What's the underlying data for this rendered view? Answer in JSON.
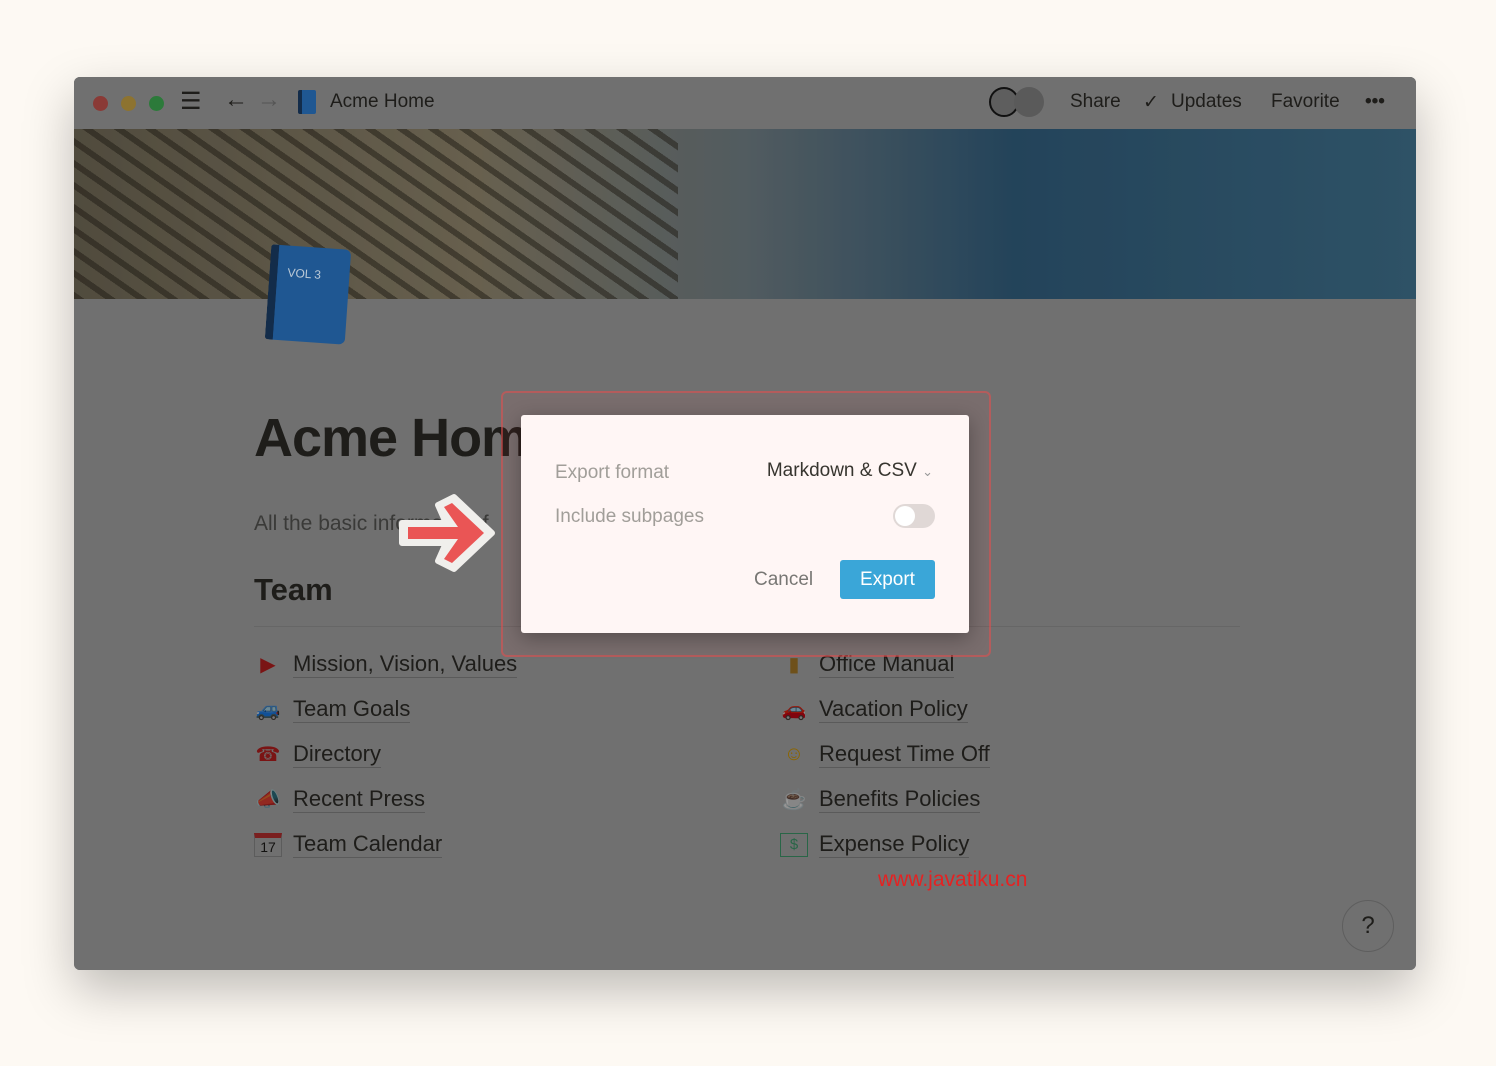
{
  "window": {
    "title": "Acme Home",
    "icon": "blue-book-icon",
    "traffic_colors": [
      "#fe5f57",
      "#febc2e",
      "#28c840"
    ]
  },
  "topbar": {
    "share": "Share",
    "updates": "Updates",
    "favorite": "Favorite",
    "more": "•••"
  },
  "page": {
    "title": "Acme Home",
    "book_label": "VOL 3",
    "subtitle": "All the basic information f",
    "section": "Team"
  },
  "links_left": [
    {
      "icon": "flag-icon",
      "glyph": "▶",
      "label": "Mission, Vision, Values"
    },
    {
      "icon": "car-icon",
      "glyph": "🚙",
      "label": "Team Goals"
    },
    {
      "icon": "telephone-icon",
      "glyph": "☎",
      "label": "Directory"
    },
    {
      "icon": "megaphone-icon",
      "glyph": "📣",
      "label": "Recent Press"
    },
    {
      "icon": "calendar-icon",
      "glyph": "17",
      "label": "Team Calendar"
    }
  ],
  "links_right": [
    {
      "icon": "ledger-icon",
      "glyph": "▮",
      "label": "Office Manual"
    },
    {
      "icon": "car-icon",
      "glyph": "🚗",
      "label": "Vacation Policy"
    },
    {
      "icon": "sleeping-face-icon",
      "glyph": "☺",
      "label": "Request Time Off"
    },
    {
      "icon": "coffee-icon",
      "glyph": "☕",
      "label": "Benefits Policies"
    },
    {
      "icon": "money-icon",
      "glyph": "$",
      "label": "Expense Policy"
    }
  ],
  "help": "?",
  "modal": {
    "format_label": "Export format",
    "format_value": "Markdown & CSV",
    "subpages_label": "Include subpages",
    "subpages_on": false,
    "cancel": "Cancel",
    "export": "Export",
    "accent": "#3aa6d8"
  },
  "watermark": "www.javatiku.cn"
}
